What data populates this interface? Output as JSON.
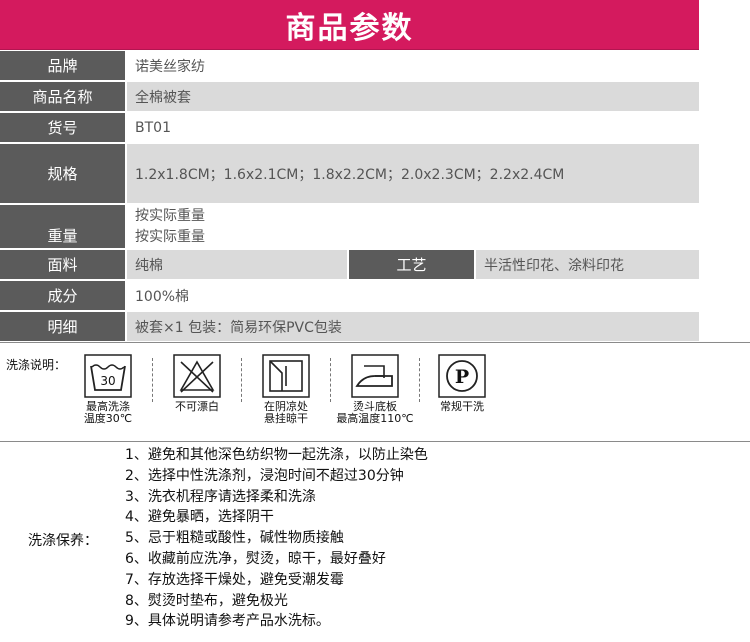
{
  "header": {
    "title": "商品参数"
  },
  "spec": {
    "brand": {
      "label": "品牌",
      "value": "诺美丝家纺"
    },
    "name": {
      "label": "商品名称",
      "value": "全棉被套"
    },
    "sku": {
      "label": "货号",
      "value": "BT01"
    },
    "size": {
      "label": "规格",
      "value": "1.2x1.8CM；1.6x2.1CM；1.8x2.2CM；2.0x2.3CM；2.2x2.4CM"
    },
    "weight": {
      "label": "重量",
      "value1": "按实际重量",
      "value2": "按实际重量"
    },
    "fabric": {
      "label": "面料",
      "value": "纯棉",
      "craft_label": "工艺",
      "craft_value": "半活性印花、涂料印花"
    },
    "composition": {
      "label": "成分",
      "value": "100%棉"
    },
    "detail": {
      "label": "明细",
      "value": "被套×1 包装：简易环保PVC包装"
    }
  },
  "wash": {
    "title": "洗涤说明：",
    "items": [
      {
        "icon": "wash-30-icon",
        "tub_number": "30",
        "line1": "最高洗涤",
        "line2": "温度30℃"
      },
      {
        "icon": "no-bleach-icon",
        "line1": "不可漂白",
        "line2": ""
      },
      {
        "icon": "shade-dry-icon",
        "line1": "在阴凉处",
        "line2": "悬挂晾干"
      },
      {
        "icon": "iron-icon",
        "line1": "烫斗底板",
        "line2": "最高温度110℃"
      },
      {
        "icon": "dry-clean-p-icon",
        "letter": "P",
        "line1": "常规干洗",
        "line2": ""
      }
    ]
  },
  "care": {
    "title": "洗涤保养：",
    "items": [
      "1、避免和其他深色纺织物一起洗涤，以防止染色",
      "2、选择中性洗涤剂，浸泡时间不超过30分钟",
      "3、洗衣机程序请选择柔和洗涤",
      "4、避免暴晒，选择阴干",
      "5、忌于粗糙或酸性，碱性物质接触",
      "6、收藏前应洗净，熨烫，晾干，最好叠好",
      "7、存放选择干燥处，避免受潮发霉",
      "8、熨烫时垫布，避免极光",
      "9、具体说明请参考产品水洗标。"
    ]
  }
}
